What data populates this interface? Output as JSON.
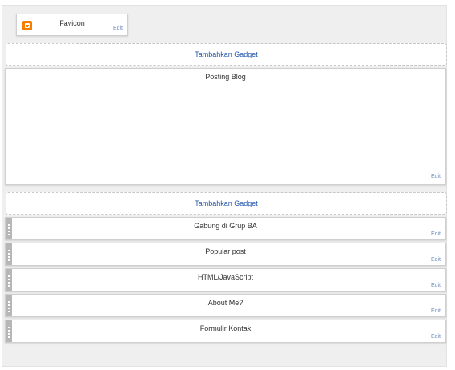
{
  "header_gadget": {
    "title": "Favicon",
    "edit": "Edit",
    "icon": "blogger-icon"
  },
  "add_gadget_label": "Tambahkan Gadget",
  "main_gadget": {
    "title": "Posting Blog",
    "edit": "Edit"
  },
  "sidebar_gadgets": [
    {
      "title": "Gabung di Grup BA",
      "edit": "Edit"
    },
    {
      "title": "Popular post",
      "edit": "Edit"
    },
    {
      "title": "HTML/JavaScript",
      "edit": "Edit"
    },
    {
      "title": "About Me?",
      "edit": "Edit"
    },
    {
      "title": "Formulir Kontak",
      "edit": "Edit"
    }
  ],
  "colors": {
    "accent_link": "#2255aa",
    "edit_link": "#6f8fbf",
    "blogger_orange": "#f57d00"
  }
}
